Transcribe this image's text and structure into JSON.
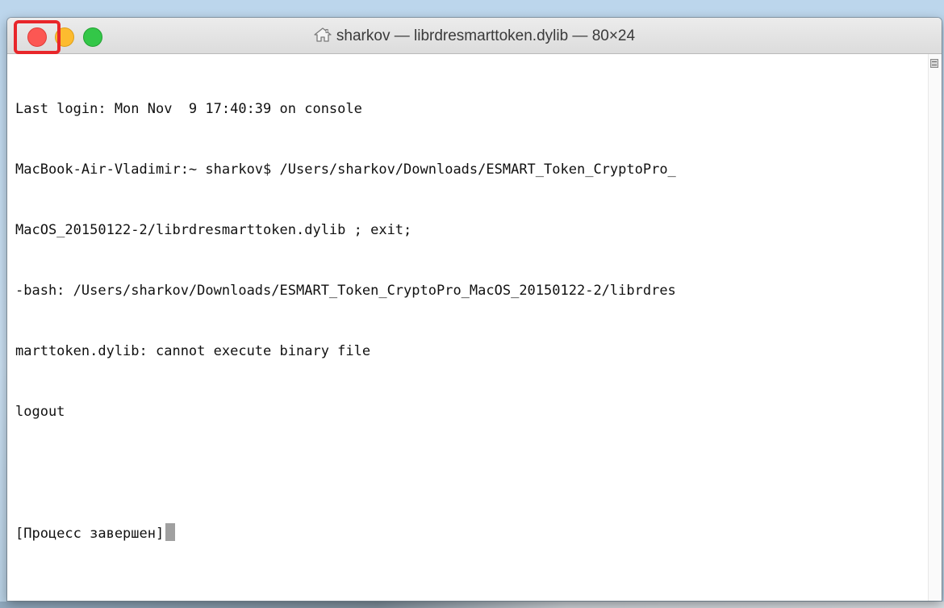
{
  "window": {
    "title": "sharkov — librdresmarttoken.dylib — 80×24",
    "title_icon": "home-icon"
  },
  "traffic_lights": {
    "close_color": "#fc5753",
    "minimize_color": "#fdbb2f",
    "zoom_color": "#33c748",
    "highlight_color": "#e8262a"
  },
  "terminal": {
    "lines": [
      "Last login: Mon Nov  9 17:40:39 on console",
      "MacBook-Air-Vladimir:~ sharkov$ /Users/sharkov/Downloads/ESMART_Token_CryptoPro_",
      "MacOS_20150122-2/librdresmarttoken.dylib ; exit;",
      "-bash: /Users/sharkov/Downloads/ESMART_Token_CryptoPro_MacOS_20150122-2/librdres",
      "marttoken.dylib: cannot execute binary file",
      "logout",
      "",
      "[Процесс завершен]"
    ]
  }
}
